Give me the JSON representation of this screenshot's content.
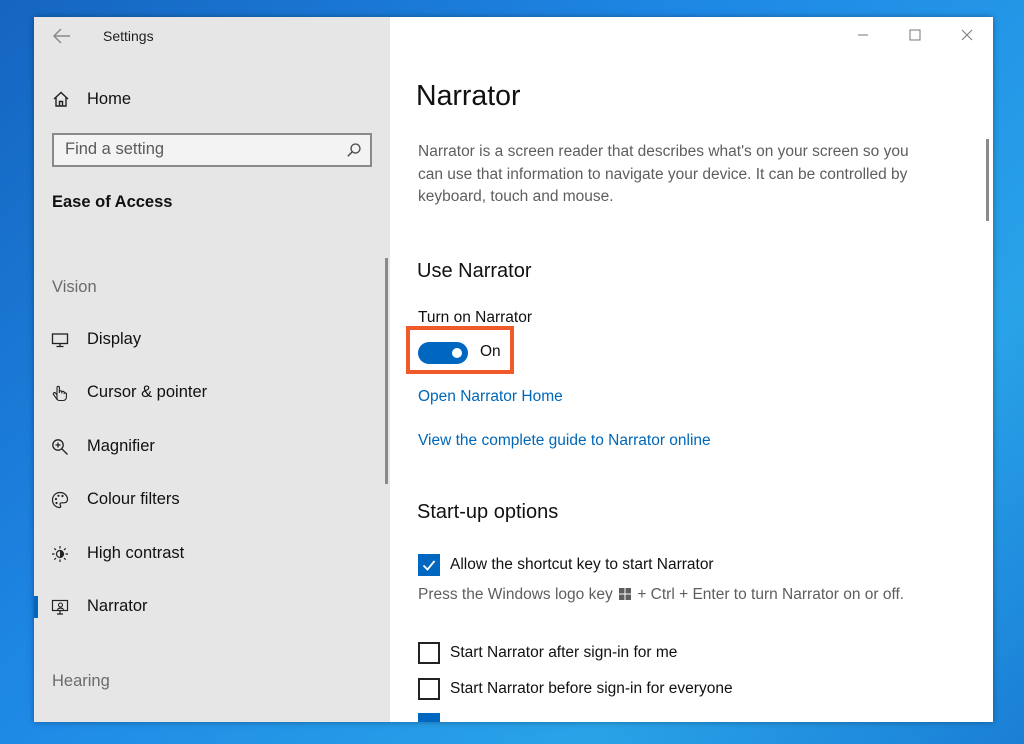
{
  "window": {
    "title": "Settings"
  },
  "sidebar": {
    "home_label": "Home",
    "search_placeholder": "Find a setting",
    "section_title": "Ease of Access",
    "group_vision": "Vision",
    "group_hearing": "Hearing",
    "items": [
      {
        "label": "Display",
        "icon": "monitor-icon"
      },
      {
        "label": "Cursor & pointer",
        "icon": "pointer-icon"
      },
      {
        "label": "Magnifier",
        "icon": "magnifier-icon"
      },
      {
        "label": "Colour filters",
        "icon": "palette-icon"
      },
      {
        "label": "High contrast",
        "icon": "sun-icon"
      },
      {
        "label": "Narrator",
        "icon": "narrator-icon",
        "selected": true
      }
    ]
  },
  "main": {
    "title": "Narrator",
    "description": "Narrator is a screen reader that describes what's on your screen so you can use that information to navigate your device. It can be controlled by keyboard, touch and mouse.",
    "use_narrator_heading": "Use Narrator",
    "toggle": {
      "label": "Turn on Narrator",
      "state_text": "On",
      "on": true
    },
    "links": {
      "open_home": "Open Narrator Home",
      "guide": "View the complete guide to Narrator online"
    },
    "startup_heading": "Start-up options",
    "shortcut_option": "Allow the shortcut key to start Narrator",
    "hint_part1": "Press the Windows logo key",
    "hint_part2": "+ Ctrl + Enter to turn Narrator on or off.",
    "options": [
      {
        "label": "Start Narrator after sign-in for me",
        "checked": false
      },
      {
        "label": "Start Narrator before sign-in for everyone",
        "checked": false
      }
    ]
  },
  "colors": {
    "accent": "#0067c0",
    "highlight": "#f05a28",
    "sidebar_bg": "#e6e6e6"
  }
}
